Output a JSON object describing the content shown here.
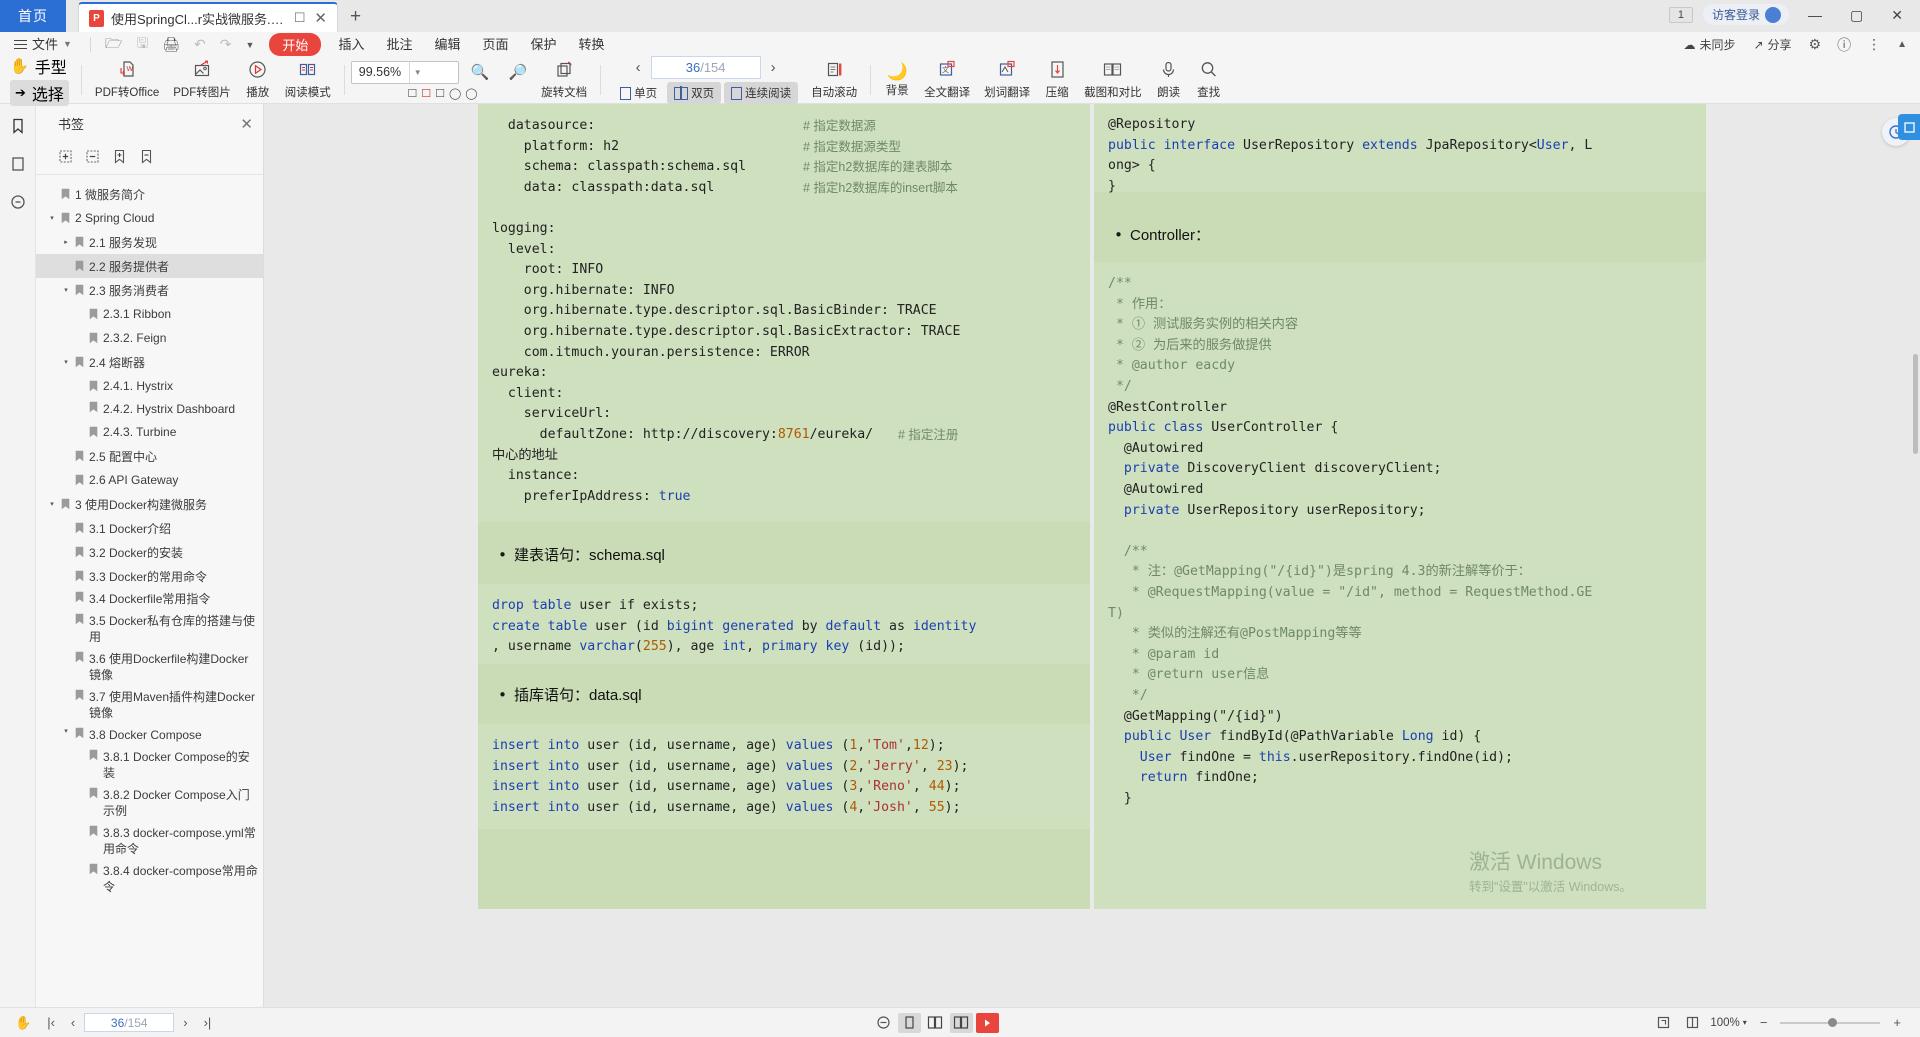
{
  "window": {
    "home_tab": "首页",
    "doc_tab_title": "使用SpringCl...r实战微服务.pdf",
    "pdf_badge": "P",
    "new_tab": "+",
    "notif_count": "1",
    "login_label": "访客登录",
    "minimize": "—",
    "maximize": "▢",
    "close": "✕"
  },
  "menu": {
    "file": "文件",
    "items": [
      "开始",
      "插入",
      "批注",
      "编辑",
      "页面",
      "保护",
      "转换"
    ],
    "quick_icons": [
      "open-icon",
      "save-icon",
      "print-icon",
      "undo-icon",
      "redo-icon",
      "more-icon"
    ],
    "right": [
      {
        "label": "未同步",
        "icon": "cloud-sync-icon"
      },
      {
        "label": "分享",
        "icon": "share-icon"
      },
      {
        "label": "",
        "icon": "gear-icon"
      },
      {
        "label": "",
        "icon": "help-icon"
      },
      {
        "label": "",
        "icon": "more-vertical-icon"
      },
      {
        "label": "",
        "icon": "collapse-ribbon-icon"
      }
    ]
  },
  "toolbar": {
    "hand": "手型",
    "select": "选择",
    "pdf_to_office": "PDF转Office",
    "pdf_to_image": "PDF转图片",
    "play": "播放",
    "read_mode": "阅读模式",
    "zoom_value": "99.56%",
    "zoom_out": "zoom-out-icon",
    "zoom_in": "zoom-in-icon",
    "rotate": "旋转文档",
    "page_current": "36",
    "page_total": "/154",
    "prev_page": "‹",
    "next_page": "›",
    "single_page": "单页",
    "double_page": "双页",
    "continuous": "连续阅读",
    "auto_scroll": "自动滚动",
    "background": "背景",
    "full_translate": "全文翻译",
    "word_translate": "划词翻译",
    "compress": "压缩",
    "compare": "截图和对比",
    "read_aloud": "朗读",
    "find": "查找"
  },
  "rail": {
    "bookmark": "bookmark-icon",
    "thumbnail": "thumbnail-icon",
    "annotation": "annotation-icon"
  },
  "bookmarks": {
    "title": "书签",
    "close": "✕",
    "tools": [
      "expand-all-icon",
      "collapse-all-icon",
      "add-bookmark-icon",
      "remove-bookmark-icon"
    ],
    "items": [
      {
        "label": "1 微服务简介",
        "depth": 0,
        "twisty": "",
        "selected": false
      },
      {
        "label": "2 Spring Cloud",
        "depth": 0,
        "twisty": "▾",
        "selected": false
      },
      {
        "label": "2.1 服务发现",
        "depth": 1,
        "twisty": "▸",
        "selected": false
      },
      {
        "label": "2.2 服务提供者",
        "depth": 1,
        "twisty": "",
        "selected": true
      },
      {
        "label": "2.3 服务消费者",
        "depth": 1,
        "twisty": "▾",
        "selected": false
      },
      {
        "label": "2.3.1 Ribbon",
        "depth": 2,
        "twisty": "",
        "selected": false
      },
      {
        "label": "2.3.2. Feign",
        "depth": 2,
        "twisty": "",
        "selected": false
      },
      {
        "label": "2.4 熔断器",
        "depth": 1,
        "twisty": "▾",
        "selected": false
      },
      {
        "label": "2.4.1. Hystrix",
        "depth": 2,
        "twisty": "",
        "selected": false
      },
      {
        "label": "2.4.2. Hystrix Dashboard",
        "depth": 2,
        "twisty": "",
        "selected": false
      },
      {
        "label": "2.4.3. Turbine",
        "depth": 2,
        "twisty": "",
        "selected": false
      },
      {
        "label": "2.5 配置中心",
        "depth": 1,
        "twisty": "",
        "selected": false
      },
      {
        "label": "2.6 API Gateway",
        "depth": 1,
        "twisty": "",
        "selected": false
      },
      {
        "label": "3 使用Docker构建微服务",
        "depth": 0,
        "twisty": "▾",
        "selected": false
      },
      {
        "label": "3.1 Docker介绍",
        "depth": 1,
        "twisty": "",
        "selected": false
      },
      {
        "label": "3.2 Docker的安装",
        "depth": 1,
        "twisty": "",
        "selected": false
      },
      {
        "label": "3.3 Docker的常用命令",
        "depth": 1,
        "twisty": "",
        "selected": false
      },
      {
        "label": "3.4 Dockerfile常用指令",
        "depth": 1,
        "twisty": "",
        "selected": false
      },
      {
        "label": "3.5 Docker私有仓库的搭建与使用",
        "depth": 1,
        "twisty": "",
        "selected": false
      },
      {
        "label": "3.6 使用Dockerfile构建Docker镜像",
        "depth": 1,
        "twisty": "",
        "selected": false
      },
      {
        "label": "3.7 使用Maven插件构建Docker镜像",
        "depth": 1,
        "twisty": "",
        "selected": false
      },
      {
        "label": "3.8 Docker Compose",
        "depth": 1,
        "twisty": "▾",
        "selected": false
      },
      {
        "label": "3.8.1 Docker Compose的安装",
        "depth": 2,
        "twisty": "",
        "selected": false
      },
      {
        "label": "3.8.2 Docker Compose入门示例",
        "depth": 2,
        "twisty": "",
        "selected": false
      },
      {
        "label": "3.8.3 docker-compose.yml常用命令",
        "depth": 2,
        "twisty": "",
        "selected": false
      },
      {
        "label": "3.8.4 docker-compose常用命令",
        "depth": 2,
        "twisty": "",
        "selected": false
      }
    ]
  },
  "document": {
    "left_page": {
      "yaml_lines": [
        {
          "code": "  datasource:",
          "comment": "# 指定数据源"
        },
        {
          "code": "    platform: h2",
          "comment": "# 指定数据源类型"
        },
        {
          "code": "    schema: classpath:schema.sql",
          "comment": "# 指定h2数据库的建表脚本"
        },
        {
          "code": "    data: classpath:data.sql",
          "comment": "# 指定h2数据库的insert脚本"
        },
        {
          "code": "",
          "comment": ""
        },
        {
          "code": "logging:",
          "comment": ""
        },
        {
          "code": "  level:",
          "comment": ""
        },
        {
          "code": "    root: INFO",
          "comment": ""
        },
        {
          "code": "    org.hibernate: INFO",
          "comment": ""
        },
        {
          "code": "    org.hibernate.type.descriptor.sql.BasicBinder: TRACE",
          "comment": ""
        },
        {
          "code": "    org.hibernate.type.descriptor.sql.BasicExtractor: TRACE",
          "comment": ""
        },
        {
          "code": "    com.itmuch.youran.persistence: ERROR",
          "comment": ""
        },
        {
          "code": "eureka:",
          "comment": ""
        },
        {
          "code": "  client:",
          "comment": ""
        },
        {
          "code": "    serviceUrl:",
          "comment": ""
        },
        {
          "code": "      defaultZone: http://discovery:8761/eureka/",
          "comment": "# 指定注册"
        },
        {
          "code": "中心的地址",
          "comment": ""
        },
        {
          "code": "  instance:",
          "comment": ""
        },
        {
          "code": "    preferIpAddress: true",
          "comment": ""
        }
      ],
      "heading_schema": "建表语句：schema.sql",
      "schema_sql": [
        "drop table user if exists;",
        "create table user (id bigint generated by default as identity",
        ", username varchar(255), age int, primary key (id));"
      ],
      "heading_data": "插库语句：data.sql",
      "data_sql": [
        "insert into user (id, username, age) values (1,'Tom',12);",
        "insert into user (id, username, age) values (2,'Jerry', 23);",
        "insert into user (id, username, age) values (3,'Reno', 44);",
        "insert into user (id, username, age) values (4,'Josh', 55);"
      ]
    },
    "right_page": {
      "repo_lines": [
        "@Repository",
        "public interface UserRepository extends JpaRepository<User, L",
        "ong> {",
        "}"
      ],
      "heading_controller": "Controller：",
      "controller_lines": [
        "/**",
        " * 作用：",
        " * ① 测试服务实例的相关内容",
        " * ② 为后来的服务做提供",
        " * @author eacdy",
        " */",
        "@RestController",
        "public class UserController {",
        "  @Autowired",
        "  private DiscoveryClient discoveryClient;",
        "  @Autowired",
        "  private UserRepository userRepository;",
        "",
        "  /**",
        "   * 注：@GetMapping(\"/{id}\")是spring 4.3的新注解等价于：",
        "   * @RequestMapping(value = \"/id\", method = RequestMethod.GE",
        "T)",
        "   * 类似的注解还有@PostMapping等等",
        "   * @param id",
        "   * @return user信息",
        "   */",
        "  @GetMapping(\"/{id}\")",
        "  public User findById(@PathVariable Long id) {",
        "    User findOne = this.userRepository.findOne(id);",
        "    return findOne;",
        "  }"
      ]
    },
    "watermark_line1": "激活 Windows",
    "watermark_line2": "转到\"设置\"以激活 Windows。"
  },
  "status": {
    "first_page": "|‹",
    "prev_page": "‹",
    "page_current": "36",
    "page_total": "/154",
    "next_page": "›",
    "last_page": "›|",
    "view_icons": [
      "fit-page-icon",
      "single-page-icon",
      "double-page-icon",
      "continuous-icon",
      "presentation-icon"
    ],
    "right_icons": [
      "rotate-icon",
      "split-icon"
    ],
    "zoom_label": "100%",
    "zoom_caret": "▾",
    "zoom_out": "−",
    "zoom_in": "+"
  }
}
